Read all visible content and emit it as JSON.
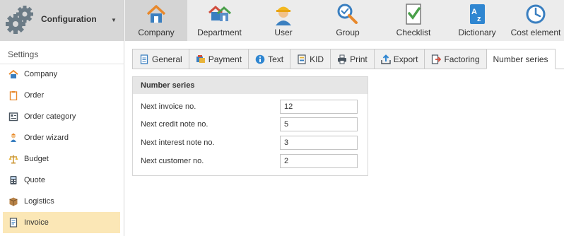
{
  "config": {
    "label": "Configuration"
  },
  "ribbon": [
    {
      "label": "Company",
      "icon": "house-icon",
      "active": true
    },
    {
      "label": "Department",
      "icon": "houses-icon"
    },
    {
      "label": "User",
      "icon": "worker-icon"
    },
    {
      "label": "Group",
      "icon": "group-search-icon"
    },
    {
      "label": "Checklist",
      "icon": "checklist-icon"
    },
    {
      "label": "Dictionary",
      "icon": "dictionary-icon"
    },
    {
      "label": "Cost element",
      "icon": "clock-icon"
    }
  ],
  "sidebar": {
    "title": "Settings",
    "items": [
      {
        "label": "Company",
        "icon": "house-icon"
      },
      {
        "label": "Order",
        "icon": "clipboard-icon"
      },
      {
        "label": "Order category",
        "icon": "category-icon"
      },
      {
        "label": "Order wizard",
        "icon": "wizard-icon"
      },
      {
        "label": "Budget",
        "icon": "scales-icon"
      },
      {
        "label": "Quote",
        "icon": "calculator-icon"
      },
      {
        "label": "Logistics",
        "icon": "box-icon"
      },
      {
        "label": "Invoice",
        "icon": "invoice-icon",
        "active": true
      }
    ]
  },
  "tabs": [
    {
      "label": "General",
      "icon": "document-icon"
    },
    {
      "label": "Payment",
      "icon": "payment-icon"
    },
    {
      "label": "Text",
      "icon": "info-icon"
    },
    {
      "label": "KID",
      "icon": "kid-icon"
    },
    {
      "label": "Print",
      "icon": "printer-icon"
    },
    {
      "label": "Export",
      "icon": "export-icon"
    },
    {
      "label": "Factoring",
      "icon": "factoring-icon"
    },
    {
      "label": "Number series",
      "active": true
    }
  ],
  "group": {
    "title": "Number series",
    "fields": [
      {
        "label": "Next invoice no.",
        "value": "12"
      },
      {
        "label": "Next credit note no.",
        "value": "5"
      },
      {
        "label": "Next interest note no.",
        "value": "3"
      },
      {
        "label": "Next customer no.",
        "value": "2"
      }
    ]
  },
  "colors": {
    "ribbon_bg": "#ececec",
    "active_ribbon": "#d4d4d4",
    "sidebar_active": "#fbe7b6",
    "accent_orange": "#e8882b",
    "accent_blue": "#3a86c8"
  }
}
